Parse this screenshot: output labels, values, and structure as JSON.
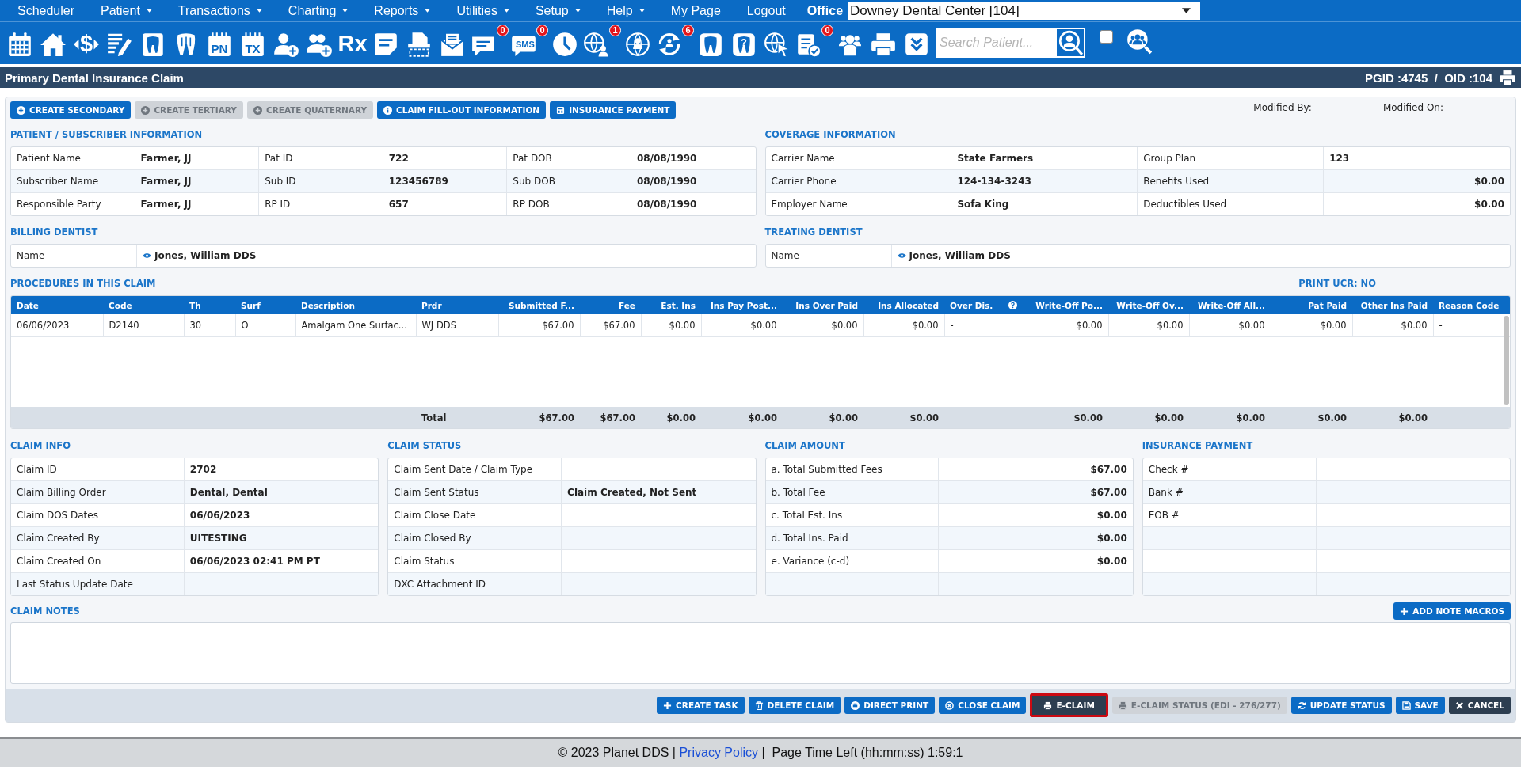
{
  "menu": [
    {
      "label": "Scheduler",
      "dropdown": false
    },
    {
      "label": "Patient",
      "dropdown": true
    },
    {
      "label": "Transactions",
      "dropdown": true
    },
    {
      "label": "Charting",
      "dropdown": true
    },
    {
      "label": "Reports",
      "dropdown": true
    },
    {
      "label": "Utilities",
      "dropdown": true
    },
    {
      "label": "Setup",
      "dropdown": true
    },
    {
      "label": "Help",
      "dropdown": true
    },
    {
      "label": "My Page",
      "dropdown": false
    },
    {
      "label": "Logout",
      "dropdown": false
    }
  ],
  "office": {
    "label": "Office",
    "value": "Downey Dental Center [104]"
  },
  "toolbar": {
    "dollar": "$",
    "pn": "PN",
    "tx": "TX",
    "rx": "Rx",
    "sms": "SMS",
    "help": "?",
    "chat_badge": "0",
    "sms_badge": "0",
    "globe_badge": "1",
    "sync_badge": "6",
    "claims_badge": "0"
  },
  "search": {
    "placeholder": "Search Patient...",
    "checked": false
  },
  "title": "Primary Dental Insurance Claim",
  "ids": "PGID :4745  /  OID :104",
  "actions": [
    {
      "label": "CREATE SECONDARY",
      "disabled": false
    },
    {
      "label": "CREATE TERTIARY",
      "disabled": true
    },
    {
      "label": "CREATE QUATERNARY",
      "disabled": true
    },
    {
      "label": "CLAIM FILL-OUT INFORMATION",
      "disabled": false
    },
    {
      "label": "INSURANCE PAYMENT",
      "disabled": false
    }
  ],
  "modified": [
    "Modified By:",
    "Modified On:"
  ],
  "patient": {
    "heading": "PATIENT / SUBSCRIBER INFORMATION",
    "rows": [
      {
        "cells": [
          "Patient Name",
          "Farmer, JJ",
          "Pat ID",
          "722",
          "Pat DOB",
          "08/08/1990"
        ]
      },
      {
        "cells": [
          "Subscriber Name",
          "Farmer, JJ",
          "Sub ID",
          "123456789",
          "Sub DOB",
          "08/08/1990"
        ]
      },
      {
        "cells": [
          "Responsible Party",
          "Farmer, JJ",
          "RP ID",
          "657",
          "RP DOB",
          "08/08/1990"
        ]
      }
    ]
  },
  "coverage": {
    "heading": "COVERAGE INFORMATION",
    "rows": [
      {
        "kind": "text",
        "cells": [
          "Carrier Name",
          "State Farmers",
          "Group Plan",
          "123"
        ]
      },
      {
        "kind": "amount",
        "cells": [
          "Carrier Phone",
          "124-134-3243",
          "Benefits Used",
          "$0.00"
        ]
      },
      {
        "kind": "amount",
        "cells": [
          "Employer Name",
          "Sofa King",
          "Deductibles Used",
          "$0.00"
        ]
      }
    ]
  },
  "billing": {
    "heading": "BILLING DENTIST",
    "label": "Name",
    "value": "Jones, William DDS"
  },
  "treating": {
    "heading": "TREATING DENTIST",
    "label": "Name",
    "value": "Jones, William DDS"
  },
  "procedures": {
    "heading": "PROCEDURES IN THIS CLAIM",
    "print_ucr": "PRINT UCR: NO",
    "columns": [
      {
        "label": "Date",
        "kind": "text"
      },
      {
        "label": "Code",
        "kind": "text"
      },
      {
        "label": "Th",
        "kind": "text"
      },
      {
        "label": "Surf",
        "kind": "text"
      },
      {
        "label": "Description",
        "kind": "text"
      },
      {
        "label": "Prdr",
        "kind": "text"
      },
      {
        "label": "Submitted F...",
        "kind": "amount"
      },
      {
        "label": "Fee",
        "kind": "amount"
      },
      {
        "label": "Est. Ins",
        "kind": "amount"
      },
      {
        "label": "Ins Pay Post...",
        "kind": "amount"
      },
      {
        "label": "Ins Over Paid",
        "kind": "amount"
      },
      {
        "label": "Ins Allocated",
        "kind": "amount"
      },
      {
        "label": "Over Dis.",
        "kind": "help"
      },
      {
        "label": "Write-Off Po...",
        "kind": "amount"
      },
      {
        "label": "Write-Off Ov...",
        "kind": "amount"
      },
      {
        "label": "Write-Off All...",
        "kind": "amount"
      },
      {
        "label": "Pat Paid",
        "kind": "amount"
      },
      {
        "label": "Other Ins Paid",
        "kind": "amount"
      },
      {
        "label": "Reason Code",
        "kind": "text"
      }
    ],
    "rows": [
      [
        "06/06/2023",
        "D2140",
        "30",
        "O",
        "Amalgam One Surfac...",
        "WJ DDS",
        "$67.00",
        "$67.00",
        "$0.00",
        "$0.00",
        "$0.00",
        "$0.00",
        "-",
        "$0.00",
        "$0.00",
        "$0.00",
        "$0.00",
        "$0.00",
        "-"
      ]
    ],
    "total": [
      {
        "kind": "blank"
      },
      {
        "kind": "blank"
      },
      {
        "kind": "blank"
      },
      {
        "kind": "blank"
      },
      {
        "kind": "blank"
      },
      {
        "kind": "label",
        "text": "Total"
      },
      {
        "kind": "amount",
        "text": "$67.00"
      },
      {
        "kind": "amount",
        "text": "$67.00"
      },
      {
        "kind": "amount",
        "text": "$0.00"
      },
      {
        "kind": "amount",
        "text": "$0.00"
      },
      {
        "kind": "amount",
        "text": "$0.00"
      },
      {
        "kind": "amount",
        "text": "$0.00"
      },
      {
        "kind": "blank"
      },
      {
        "kind": "amount",
        "text": "$0.00"
      },
      {
        "kind": "amount",
        "text": "$0.00"
      },
      {
        "kind": "amount",
        "text": "$0.00"
      },
      {
        "kind": "amount",
        "text": "$0.00"
      },
      {
        "kind": "amount",
        "text": "$0.00"
      },
      {
        "kind": "blank"
      }
    ]
  },
  "sections": [
    {
      "heading": "CLAIM INFO",
      "kind": "text",
      "rows": [
        {
          "label": "Claim ID",
          "value": "2702"
        },
        {
          "label": "Claim Billing Order",
          "value": "Dental, Dental"
        },
        {
          "label": "Claim DOS Dates",
          "value": "06/06/2023"
        },
        {
          "label": "Claim Created By",
          "value": "UITESTING"
        },
        {
          "label": "Claim Created On",
          "value": "06/06/2023 02:41 PM PT"
        },
        {
          "label": "Last Status Update Date"
        }
      ]
    },
    {
      "heading": "CLAIM STATUS",
      "kind": "text",
      "rows": [
        {
          "label": "Claim Sent Date / Claim Type"
        },
        {
          "label": "Claim Sent Status",
          "value": "Claim Created, Not Sent"
        },
        {
          "label": "Claim Close Date"
        },
        {
          "label": "Claim Closed By"
        },
        {
          "label": "Claim Status"
        },
        {
          "label": "DXC Attachment ID"
        }
      ]
    },
    {
      "heading": "CLAIM AMOUNT",
      "kind": "amount",
      "rows": [
        {
          "label": "a. Total Submitted Fees",
          "value": "$67.00"
        },
        {
          "label": "b. Total Fee",
          "value": "$67.00"
        },
        {
          "label": "c. Total Est. Ins",
          "value": "$0.00"
        },
        {
          "label": "d. Total Ins. Paid",
          "value": "$0.00"
        },
        {
          "label": "e. Variance (c-d)",
          "value": "$0.00"
        }
      ]
    },
    {
      "heading": "INSURANCE PAYMENT",
      "kind": "text",
      "rows": [
        {
          "label": "Check #"
        },
        {
          "label": "Bank #"
        },
        {
          "label": "EOB #"
        }
      ]
    }
  ],
  "notes": {
    "heading": "CLAIM NOTES",
    "button": "ADD NOTE MACROS"
  },
  "buttons": [
    {
      "label": "CREATE TASK",
      "kind": "primary",
      "disabled": false,
      "highlighted": false
    },
    {
      "label": "DELETE CLAIM",
      "kind": "primary",
      "disabled": false,
      "highlighted": false
    },
    {
      "label": "DIRECT PRINT",
      "kind": "primary",
      "disabled": false,
      "highlighted": false
    },
    {
      "label": "CLOSE CLAIM",
      "kind": "primary",
      "disabled": false,
      "highlighted": false
    },
    {
      "label": "E-CLAIM",
      "kind": "dark",
      "disabled": false,
      "highlighted": true
    },
    {
      "label": "E-CLAIM STATUS (EDI - 276/277)",
      "kind": "primary",
      "disabled": true,
      "highlighted": false
    },
    {
      "label": "UPDATE STATUS",
      "kind": "primary",
      "disabled": false,
      "highlighted": false
    },
    {
      "label": "SAVE",
      "kind": "primary",
      "disabled": false,
      "highlighted": false
    },
    {
      "label": "CANCEL",
      "kind": "dark",
      "disabled": false,
      "highlighted": false
    }
  ],
  "footer": {
    "before": "© 2023 Planet DDS |",
    "link": "Privacy Policy",
    "after": "|  Page Time Left (hh:mm:ss) 1:59:1"
  }
}
